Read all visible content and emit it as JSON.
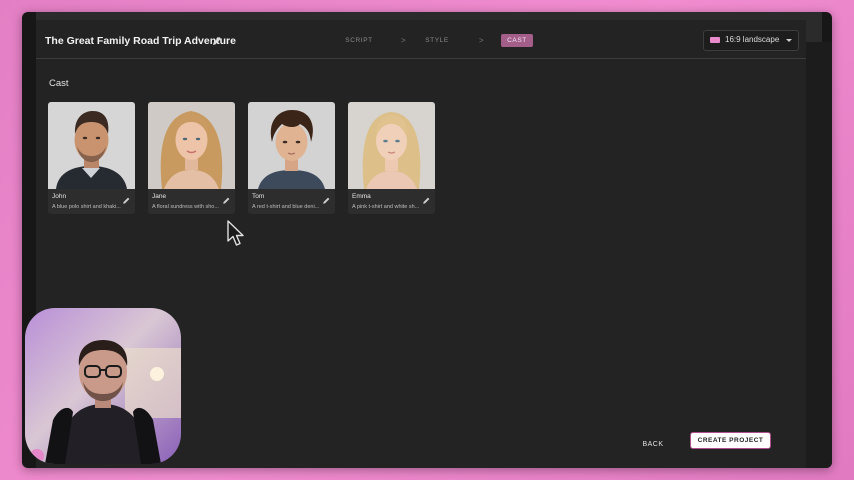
{
  "header": {
    "project_title": "The Great Family Road Trip Adventure",
    "steps": [
      {
        "label": "SCRIPT",
        "active": false
      },
      {
        "label": "STYLE",
        "active": false
      },
      {
        "label": "CAST",
        "active": true
      }
    ],
    "step_separator": ">",
    "aspect_ratio": {
      "label": "16:9 landscape",
      "swatch_color": "#e98acb"
    }
  },
  "main": {
    "section_title": "Cast",
    "cast": [
      {
        "name": "John",
        "description": "A blue polo shirt and khaki..."
      },
      {
        "name": "Jane",
        "description": "A floral sundress with sho..."
      },
      {
        "name": "Tom",
        "description": "A red t-shirt and blue deni..."
      },
      {
        "name": "Emma",
        "description": "A pink t-shirt and white sh..."
      }
    ]
  },
  "footer": {
    "back_label": "BACK",
    "create_label": "CREATE PROJECT"
  },
  "colors": {
    "accent": "#a35e8a",
    "background": "#232323",
    "desktop": "#ef8bcd"
  }
}
